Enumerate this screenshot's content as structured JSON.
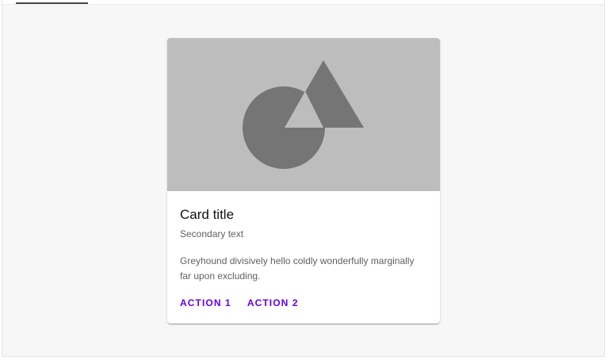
{
  "card": {
    "title": "Card title",
    "subtitle": "Secondary text",
    "body": "Greyhound divisively hello coldly wonderfully marginally far upon excluding.",
    "actions": [
      "ACTION 1",
      "ACTION 2"
    ],
    "media_icon": "shapes-placeholder-icon"
  },
  "colors": {
    "accent": "#6200ee",
    "media_background": "#bdbdbd",
    "shape_fill": "#757575",
    "page_background": "#f7f7f7"
  }
}
